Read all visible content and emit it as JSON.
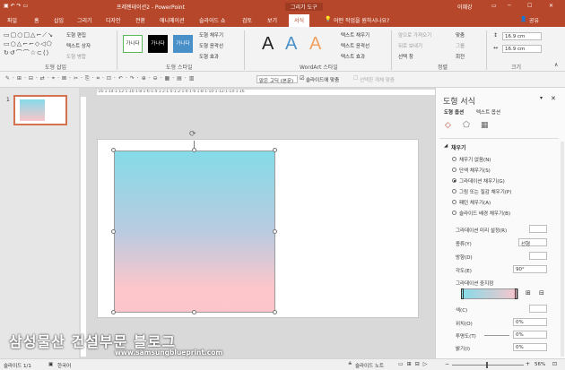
{
  "titlebar": {
    "doc_title": "프레젠테이션2 - PowerPoint",
    "context_tab": "그리기 도구",
    "user": "이혜강"
  },
  "ribbon_tabs": [
    "파일",
    "홈",
    "삽입",
    "그리기",
    "디자인",
    "전환",
    "애니메이션",
    "슬라이드 쇼",
    "검토",
    "보기",
    "서식"
  ],
  "tell_me": "어떤 작업을 원하시나요?",
  "share": "공유",
  "ribbon": {
    "insert_shapes": {
      "edit_shape": "도형 편집",
      "text_box": "텍스트 상자",
      "merge_shapes": "도형 병합",
      "label": "도형 삽입"
    },
    "shape_styles": {
      "preset": "가나다",
      "fill": "도형 채우기",
      "outline": "도형 윤곽선",
      "effects": "도형 효과",
      "label": "도형 스타일"
    },
    "wordart": {
      "sample": "A",
      "text_fill": "텍스트 채우기",
      "text_outline": "텍스트 윤곽선",
      "text_effects": "텍스트 효과",
      "label": "WordArt 스타일"
    },
    "arrange": {
      "bring_forward": "앞으로 가져오기",
      "send_backward": "뒤로 보내기",
      "selection_pane": "선택 창",
      "align": "맞춤",
      "group": "그룹",
      "rotate": "회전",
      "label": "정렬"
    },
    "size": {
      "height": "16.9 cm",
      "width": "16.9 cm",
      "label": "크기"
    }
  },
  "qat": {
    "font": "맑은 고딕 (본문)",
    "fit_slide": "슬라이드에 맞춤",
    "select_same": "선택한 개체 맞춤"
  },
  "ruler": "·16·1·14·1·12·1·10·1·8·1·6·1·4·1·2·1·0·1·2·1·4·1·6·1·8·1·10·1·12·1·14·1·16",
  "slide_number": "1",
  "pane": {
    "title": "도형 서식",
    "tab_shape": "도형 옵션",
    "tab_text": "텍스트 옵션",
    "section": "채우기",
    "options": [
      "채우기 없음(N)",
      "단색 채우기(S)",
      "그라데이션 채우기(G)",
      "그림 또는 질감 채우기(P)",
      "패턴 채우기(A)",
      "슬라이드 배경 채우기(B)"
    ],
    "selected_option": 2,
    "preset_label": "그라데이션 미리 설정(R)",
    "type_label": "종류(Y)",
    "type_value": "선형",
    "direction_label": "방향(D)",
    "angle_label": "각도(E)",
    "angle_value": "90°",
    "stops_label": "그라데이션 중지점",
    "color_label": "색(C)",
    "position_label": "위치(O)",
    "position_value": "0%",
    "transparency_label": "투명도(T)",
    "transparency_value": "0%",
    "brightness_label": "밝기(I)",
    "brightness_value": "0%"
  },
  "status": {
    "slide": "슬라이드 1/1",
    "language": "한국어",
    "notes": "슬라이드 노트",
    "zoom": "56%"
  },
  "watermark": {
    "title": "삼성물산 건설부문 블로그",
    "url": "www.samsungblueprint.com"
  },
  "colors": {
    "accent": "#b7472a",
    "gradient_top": "#85dbe8",
    "gradient_bottom": "#fbc5cb"
  }
}
